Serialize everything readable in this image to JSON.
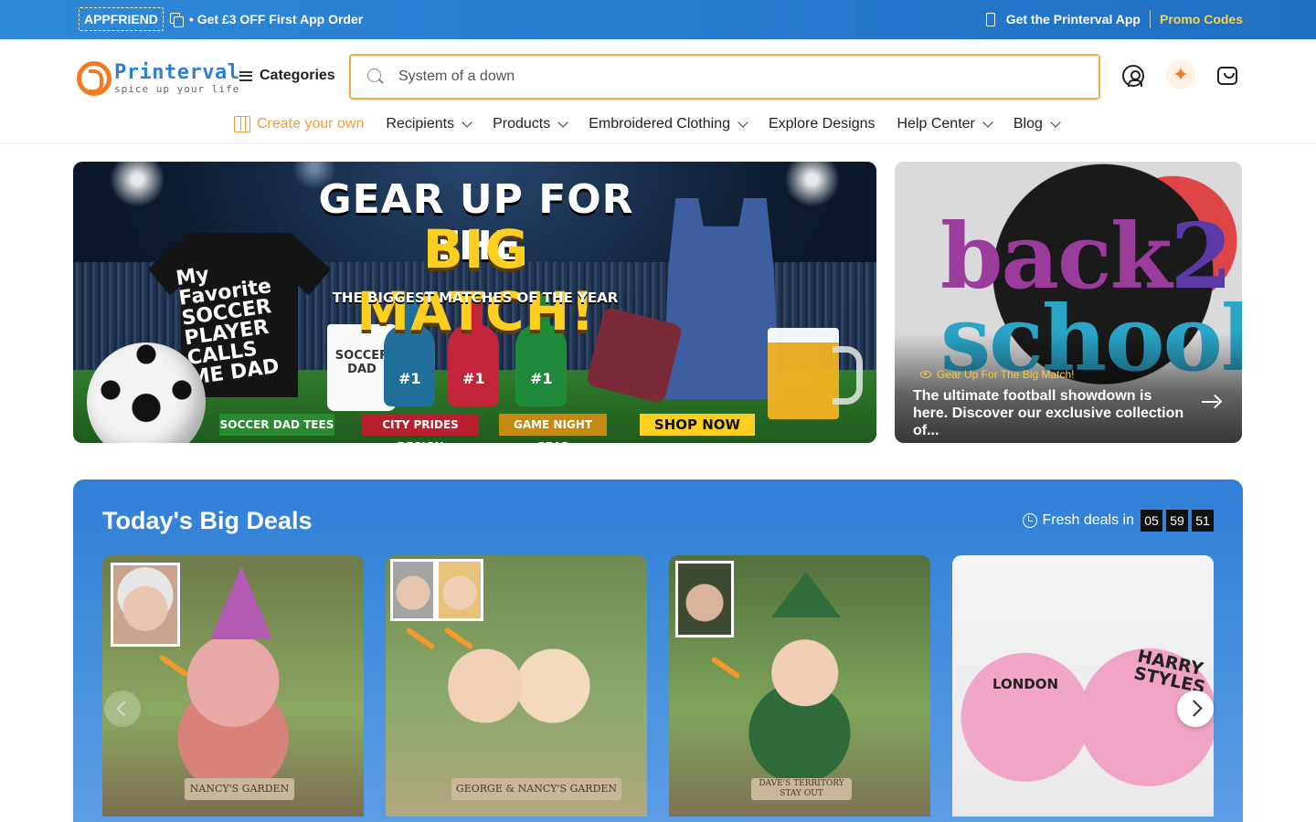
{
  "promo_bar": {
    "coupon_code": "APPFRIEND",
    "offer_text": "• Get £3 OFF First App Order",
    "app_link": "Get the Printerval App",
    "promo_link": "Promo Codes",
    "promo_link_color": "#ffd23a",
    "bg_color": "#2a80d2"
  },
  "header": {
    "logo_name": "Printerval",
    "logo_tagline": "spice up your life",
    "categories_label": "Categories",
    "search": {
      "value": "System of a down",
      "placeholder": "System of a down"
    },
    "icons": [
      "user-icon",
      "ai-sparkle-icon",
      "cart-bag-icon"
    ],
    "ai_sparkle": "✦"
  },
  "nav": {
    "items": [
      {
        "label": "Create your own",
        "has_dropdown": false,
        "icon": "design-icon"
      },
      {
        "label": "Recipients",
        "has_dropdown": true
      },
      {
        "label": "Products",
        "has_dropdown": true
      },
      {
        "label": "Embroidered Clothing",
        "has_dropdown": true
      },
      {
        "label": "Explore Designs",
        "has_dropdown": false
      },
      {
        "label": "Help Center",
        "has_dropdown": true
      },
      {
        "label": "Blog",
        "has_dropdown": true
      }
    ]
  },
  "hero": {
    "main": {
      "title_line1": "GEAR UP FOR THE",
      "title_line2": "BIG MATCH!",
      "subtitle": "THE BIGGEST MATCHES OF THE YEAR",
      "tshirt_text": "My Favorite SOCCER PLAYER CALLS ME DAD",
      "mug_text": "SOCCER DAD",
      "finger_label": "#1",
      "tags": [
        "SOCCER DAD TEES",
        "CITY PRIDES DESIGN",
        "GAME NIGHT GEAR",
        "SHOP NOW"
      ]
    },
    "side": {
      "art_text": [
        "back",
        "2",
        "school"
      ],
      "kicker": "Gear Up For The Big Match!",
      "description": "The ultimate football showdown is here. Discover our exclusive collection of..."
    }
  },
  "deals": {
    "title": "Today's Big Deals",
    "countdown_label": "Fresh deals in",
    "countdown": {
      "hours": "05",
      "minutes": "59",
      "seconds": "51"
    },
    "products": [
      {
        "plaque": "NANCY'S GARDEN"
      },
      {
        "plaque": "GEORGE & NANCY'S GARDEN"
      },
      {
        "plaque": "DAVE'S TERRITORY STAY OUT"
      },
      {
        "jersey_left": "LONDON",
        "jersey_right": "HARRY STYLES"
      }
    ]
  }
}
